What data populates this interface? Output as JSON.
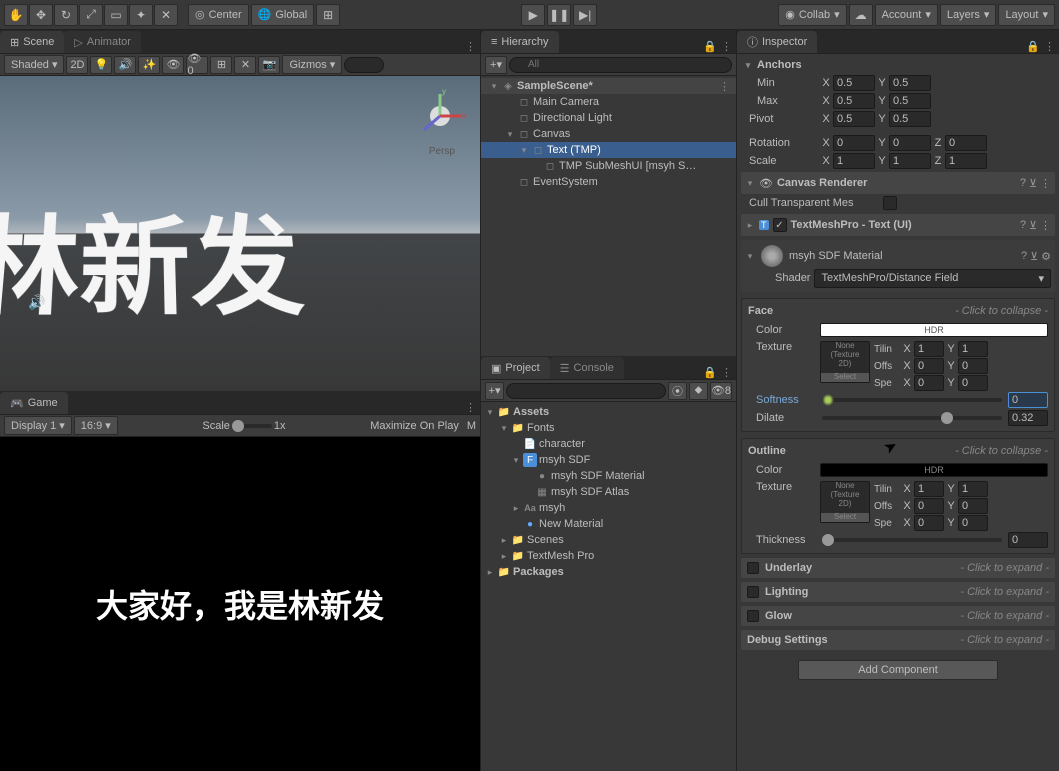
{
  "toolbar": {
    "center": "Center",
    "global": "Global",
    "collab": "Collab",
    "account": "Account",
    "layers": "Layers",
    "layout": "Layout"
  },
  "scene_tab": "Scene",
  "animator_tab": "Animator",
  "shading": "Shaded",
  "mode_2d": "2D",
  "gizmos": "Gizmos",
  "persp": "Persp",
  "scene_text": "林新发",
  "game_tab": "Game",
  "display": "Display 1",
  "aspect": "16:9",
  "scale_label": "Scale",
  "scale_value": "1x",
  "maximize": "Maximize On Play",
  "game_text": "大家好，我是林新发",
  "hierarchy_tab": "Hierarchy",
  "hierarchy_search": "All",
  "hierarchy": {
    "scene": "SampleScene*",
    "camera": "Main Camera",
    "light": "Directional Light",
    "canvas": "Canvas",
    "text": "Text (TMP)",
    "submesh": "TMP SubMeshUI [msyh S…",
    "eventsystem": "EventSystem"
  },
  "project_tab": "Project",
  "console_tab": "Console",
  "assets_count": "8",
  "project": {
    "assets": "Assets",
    "fonts": "Fonts",
    "character": "character",
    "msyh_sdf": "msyh SDF",
    "msyh_sdf_material": "msyh SDF Material",
    "msyh_sdf_atlas": "msyh SDF Atlas",
    "msyh": "msyh",
    "new_material": "New Material",
    "scenes": "Scenes",
    "textmeshpro": "TextMesh Pro",
    "packages": "Packages"
  },
  "inspector_tab": "Inspector",
  "anchors": {
    "label": "Anchors",
    "min": "Min",
    "max": "Max",
    "min_x": "0.5",
    "min_y": "0.5",
    "max_x": "0.5",
    "max_y": "0.5"
  },
  "pivot": {
    "label": "Pivot",
    "x": "0.5",
    "y": "0.5"
  },
  "rotation": {
    "label": "Rotation",
    "x": "0",
    "y": "0",
    "z": "0"
  },
  "scale": {
    "label": "Scale",
    "x": "1",
    "y": "1",
    "z": "1"
  },
  "canvas_renderer": {
    "title": "Canvas Renderer",
    "cull": "Cull Transparent Mes"
  },
  "tmp": {
    "title": "TextMeshPro - Text (UI)"
  },
  "material": {
    "name": "msyh SDF Material",
    "shader_label": "Shader",
    "shader": "TextMeshPro/Distance Field"
  },
  "face": {
    "title": "Face",
    "collapse": "- Click to collapse -",
    "color": "Color",
    "hdr": "HDR",
    "texture": "Texture",
    "tex_none": "None\n(Texture\n2D)",
    "select": "Select",
    "tiling": "Tilin",
    "offset": "Offs",
    "speed": "Spe",
    "tx": "1",
    "ty": "1",
    "ox": "0",
    "oy": "0",
    "sx": "0",
    "sy": "0",
    "softness": "Softness",
    "softness_val": "0",
    "dilate": "Dilate",
    "dilate_val": "0.32"
  },
  "outline": {
    "title": "Outline",
    "collapse": "- Click to collapse -",
    "color": "Color",
    "hdr": "HDR",
    "texture": "Texture",
    "tex_none": "None\n(Texture\n2D)",
    "select": "Select",
    "tiling": "Tilin",
    "offset": "Offs",
    "speed": "Spe",
    "tx": "1",
    "ty": "1",
    "ox": "0",
    "oy": "0",
    "sx": "0",
    "sy": "0",
    "thickness": "Thickness",
    "thickness_val": "0"
  },
  "underlay": {
    "title": "Underlay",
    "hint": "- Click to expand -"
  },
  "lighting": {
    "title": "Lighting",
    "hint": "- Click to expand -"
  },
  "glow": {
    "title": "Glow",
    "hint": "- Click to expand -"
  },
  "debug": {
    "title": "Debug Settings",
    "hint": "- Click to expand -"
  },
  "add_component": "Add Component",
  "x_label": "X",
  "y_label": "Y",
  "z_label": "Z"
}
